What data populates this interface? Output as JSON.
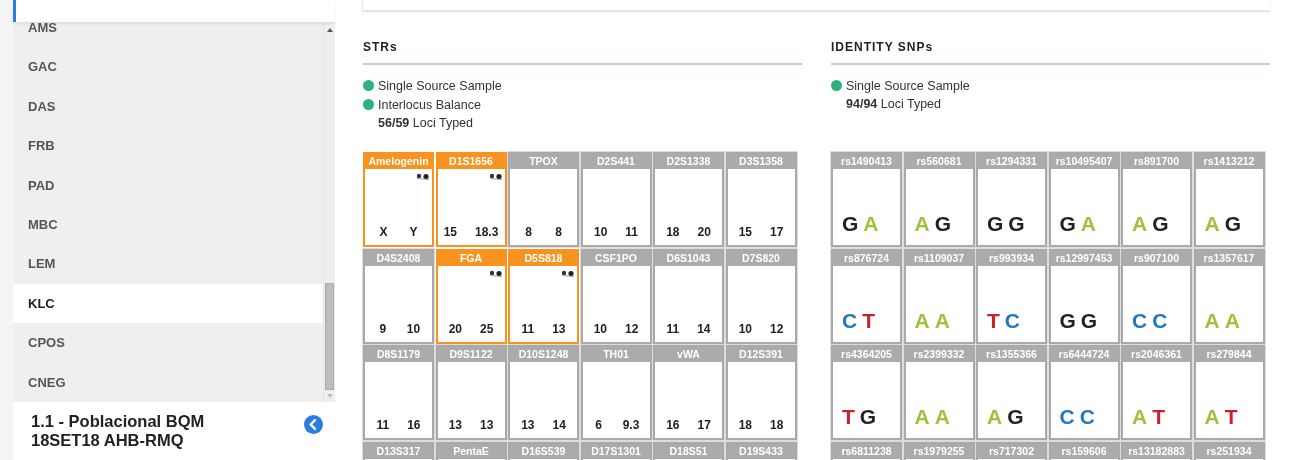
{
  "sidebar": {
    "items": [
      {
        "label": "AMS",
        "selected": false
      },
      {
        "label": "GAC",
        "selected": false
      },
      {
        "label": "DAS",
        "selected": false
      },
      {
        "label": "FRB",
        "selected": false
      },
      {
        "label": "PAD",
        "selected": false
      },
      {
        "label": "MBC",
        "selected": false
      },
      {
        "label": "LEM",
        "selected": false
      },
      {
        "label": "KLC",
        "selected": true
      },
      {
        "label": "CPOS",
        "selected": false
      },
      {
        "label": "CNEG",
        "selected": false
      }
    ],
    "run": {
      "title": "1.1 - Poblacional BQM 18SET18 AHB-RMQ"
    }
  },
  "strs": {
    "title": "STRs",
    "checks": [
      {
        "label": "Single Source Sample",
        "color": "#2db37a"
      },
      {
        "label": "Interlocus Balance",
        "color": "#2db37a"
      }
    ],
    "typed": {
      "count": "56/59",
      "label": "Loci Typed"
    },
    "loci": [
      {
        "name": "Amelogenin",
        "flagged": true,
        "alleles": [
          "X",
          "Y"
        ]
      },
      {
        "name": "D1S1656",
        "flagged": true,
        "alleles": [
          "15",
          "18.3"
        ]
      },
      {
        "name": "TPOX",
        "flagged": false,
        "alleles": [
          "8",
          "8"
        ]
      },
      {
        "name": "D2S441",
        "flagged": false,
        "alleles": [
          "10",
          "11"
        ]
      },
      {
        "name": "D2S1338",
        "flagged": false,
        "alleles": [
          "18",
          "20"
        ]
      },
      {
        "name": "D3S1358",
        "flagged": false,
        "alleles": [
          "15",
          "17"
        ]
      },
      {
        "name": "D4S2408",
        "flagged": false,
        "alleles": [
          "9",
          "10"
        ]
      },
      {
        "name": "FGA",
        "flagged": true,
        "alleles": [
          "20",
          "25"
        ]
      },
      {
        "name": "D5S818",
        "flagged": true,
        "alleles": [
          "11",
          "13"
        ]
      },
      {
        "name": "CSF1PO",
        "flagged": false,
        "alleles": [
          "10",
          "12"
        ]
      },
      {
        "name": "D6S1043",
        "flagged": false,
        "alleles": [
          "11",
          "14"
        ]
      },
      {
        "name": "D7S820",
        "flagged": false,
        "alleles": [
          "10",
          "12"
        ]
      },
      {
        "name": "D8S1179",
        "flagged": false,
        "alleles": [
          "11",
          "16"
        ]
      },
      {
        "name": "D9S1122",
        "flagged": false,
        "alleles": [
          "13",
          "13"
        ]
      },
      {
        "name": "D10S1248",
        "flagged": false,
        "alleles": [
          "13",
          "14"
        ]
      },
      {
        "name": "TH01",
        "flagged": false,
        "alleles": [
          "6",
          "9.3"
        ]
      },
      {
        "name": "vWA",
        "flagged": false,
        "alleles": [
          "16",
          "17"
        ]
      },
      {
        "name": "D12S391",
        "flagged": false,
        "alleles": [
          "18",
          "18"
        ]
      },
      {
        "name": "D13S317",
        "flagged": false
      },
      {
        "name": "PentaE",
        "flagged": false
      },
      {
        "name": "D16S539",
        "flagged": false
      },
      {
        "name": "D17S1301",
        "flagged": false
      },
      {
        "name": "D18S51",
        "flagged": false
      },
      {
        "name": "D19S433",
        "flagged": false
      }
    ]
  },
  "snps": {
    "title": "IDENTITY SNPs",
    "checks": [
      {
        "label": "Single Source Sample",
        "color": "#2db37a"
      }
    ],
    "typed": {
      "count": "94/94",
      "label": "Loci Typed"
    },
    "loci": [
      {
        "name": "rs1490413",
        "alleles": [
          {
            "base": "G",
            "color": "#222222"
          },
          {
            "base": "A",
            "color": "#9cc33b"
          }
        ]
      },
      {
        "name": "rs560681",
        "alleles": [
          {
            "base": "A",
            "color": "#9cc33b"
          },
          {
            "base": "G",
            "color": "#222222"
          }
        ]
      },
      {
        "name": "rs1294331",
        "alleles": [
          {
            "base": "G",
            "color": "#222222"
          },
          {
            "base": "G",
            "color": "#222222"
          }
        ]
      },
      {
        "name": "rs10495407",
        "alleles": [
          {
            "base": "G",
            "color": "#222222"
          },
          {
            "base": "A",
            "color": "#9cc33b"
          }
        ]
      },
      {
        "name": "rs891700",
        "alleles": [
          {
            "base": "A",
            "color": "#9cc33b"
          },
          {
            "base": "G",
            "color": "#222222"
          }
        ]
      },
      {
        "name": "rs1413212",
        "alleles": [
          {
            "base": "A",
            "color": "#9cc33b"
          },
          {
            "base": "G",
            "color": "#222222"
          }
        ]
      },
      {
        "name": "rs876724",
        "alleles": [
          {
            "base": "C",
            "color": "#1f78c1"
          },
          {
            "base": "T",
            "color": "#c8202f"
          }
        ]
      },
      {
        "name": "rs1109037",
        "alleles": [
          {
            "base": "A",
            "color": "#9cc33b"
          },
          {
            "base": "A",
            "color": "#9cc33b"
          }
        ]
      },
      {
        "name": "rs993934",
        "alleles": [
          {
            "base": "T",
            "color": "#c8202f"
          },
          {
            "base": "C",
            "color": "#1f78c1"
          }
        ]
      },
      {
        "name": "rs12997453",
        "alleles": [
          {
            "base": "G",
            "color": "#222222"
          },
          {
            "base": "G",
            "color": "#222222"
          }
        ]
      },
      {
        "name": "rs907100",
        "alleles": [
          {
            "base": "C",
            "color": "#1f78c1"
          },
          {
            "base": "C",
            "color": "#1f78c1"
          }
        ]
      },
      {
        "name": "rs1357617",
        "alleles": [
          {
            "base": "A",
            "color": "#9cc33b"
          },
          {
            "base": "A",
            "color": "#9cc33b"
          }
        ]
      },
      {
        "name": "rs4364205",
        "alleles": [
          {
            "base": "T",
            "color": "#c8202f"
          },
          {
            "base": "G",
            "color": "#222222"
          }
        ]
      },
      {
        "name": "rs2399332",
        "alleles": [
          {
            "base": "A",
            "color": "#9cc33b"
          },
          {
            "base": "A",
            "color": "#9cc33b"
          }
        ]
      },
      {
        "name": "rs1355366",
        "alleles": [
          {
            "base": "A",
            "color": "#9cc33b"
          },
          {
            "base": "G",
            "color": "#222222"
          }
        ]
      },
      {
        "name": "rs6444724",
        "alleles": [
          {
            "base": "C",
            "color": "#1f78c1"
          },
          {
            "base": "C",
            "color": "#1f78c1"
          }
        ]
      },
      {
        "name": "rs2046361",
        "alleles": [
          {
            "base": "A",
            "color": "#9cc33b"
          },
          {
            "base": "T",
            "color": "#c8202f"
          }
        ]
      },
      {
        "name": "rs279844",
        "alleles": [
          {
            "base": "A",
            "color": "#9cc33b"
          },
          {
            "base": "T",
            "color": "#c8202f"
          }
        ]
      },
      {
        "name": "rs6811238"
      },
      {
        "name": "rs1979255"
      },
      {
        "name": "rs717302"
      },
      {
        "name": "rs159606"
      },
      {
        "name": "rs13182883"
      },
      {
        "name": "rs251934"
      }
    ]
  }
}
